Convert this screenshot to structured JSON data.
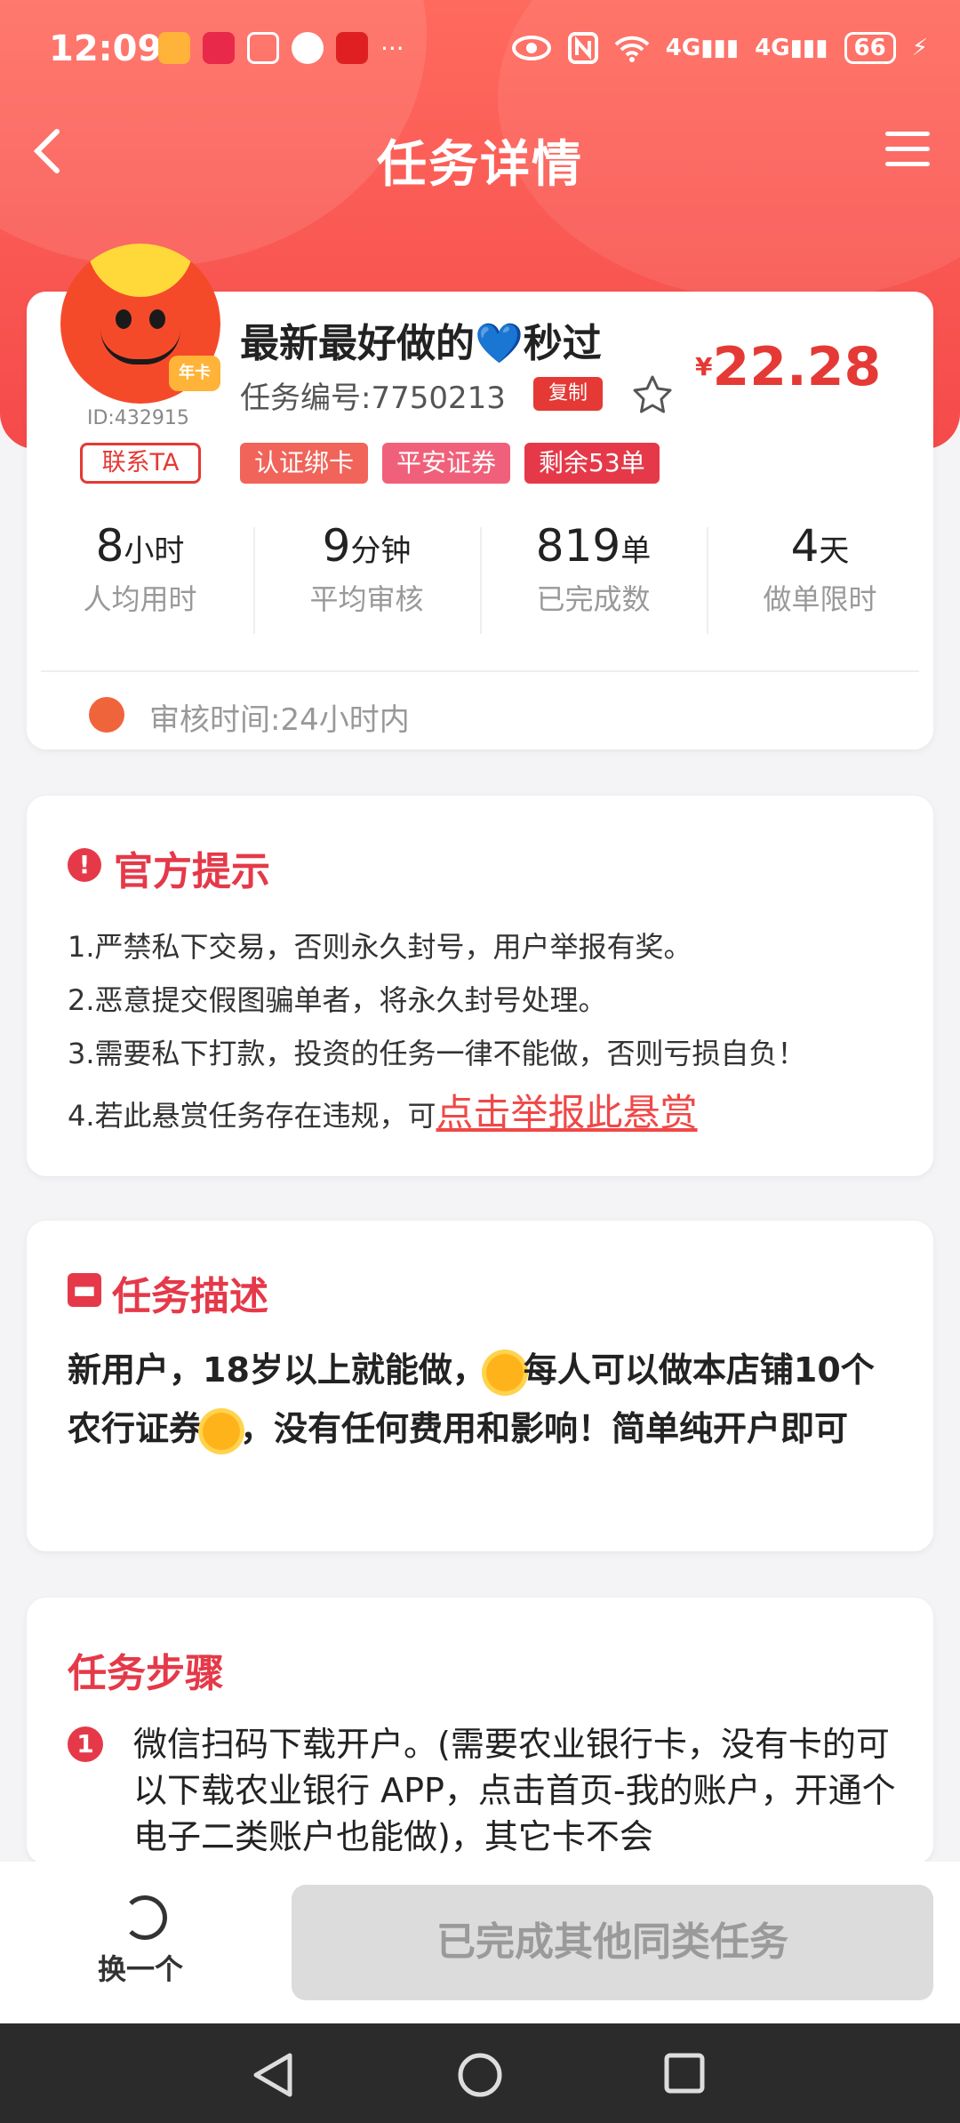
{
  "status_bar": {
    "time": "12:09",
    "battery": "66",
    "net1": "4G",
    "net2": "4G"
  },
  "nav": {
    "title": "任务详情"
  },
  "publisher": {
    "id": "ID:432915",
    "badge": "年卡",
    "contact_label": "联系TA"
  },
  "task": {
    "title": "最新最好做的",
    "title_suffix": "秒过",
    "heart": "💙",
    "number": "任务编号:7750213",
    "copy_label": "复制",
    "currency": "¥",
    "price": "22.28",
    "tags": [
      "认证绑卡",
      "平安证券",
      "剩余53单"
    ],
    "tag_colors": [
      "#f0645a",
      "#f0607a",
      "#e53949"
    ]
  },
  "stats": [
    {
      "value": "8",
      "unit": "小时",
      "label": "人均用时"
    },
    {
      "value": "9",
      "unit": "分钟",
      "label": "平均审核"
    },
    {
      "value": "819",
      "unit": "单",
      "label": "已完成数"
    },
    {
      "value": "4",
      "unit": "天",
      "label": "做单限时"
    }
  ],
  "review_time": "审核时间:24小时内",
  "notice": {
    "title": "官方提示",
    "lines": [
      "1.严禁私下交易，否则永久封号，用户举报有奖。",
      "2.恶意提交假图骗单者，将永久封号处理。",
      "3.需要私下打款，投资的任务一律不能做，否则亏损自负！",
      "4.若此悬赏任务存在违规，可"
    ],
    "report_link": "点击举报此悬赏"
  },
  "description": {
    "title": "任务描述",
    "text_a": "新用户，18岁以上就能做，",
    "text_b": "每人可以做本店铺10个农行证券",
    "text_c": "，没有任何费用和影响！简单纯开户即可"
  },
  "steps": {
    "title": "任务步骤",
    "items": [
      {
        "num": "1",
        "text": "微信扫码下载开户。(需要农业银行卡，没有卡的可以下载农业银行 APP，点击首页-我的账户，开通个电子二类账户也能做)，其它卡不会"
      }
    ]
  },
  "bottom": {
    "swap_label": "换一个",
    "done_label": "已完成其他同类任务"
  },
  "colors": {
    "accent": "#e53949",
    "header": "#f54a4a"
  }
}
